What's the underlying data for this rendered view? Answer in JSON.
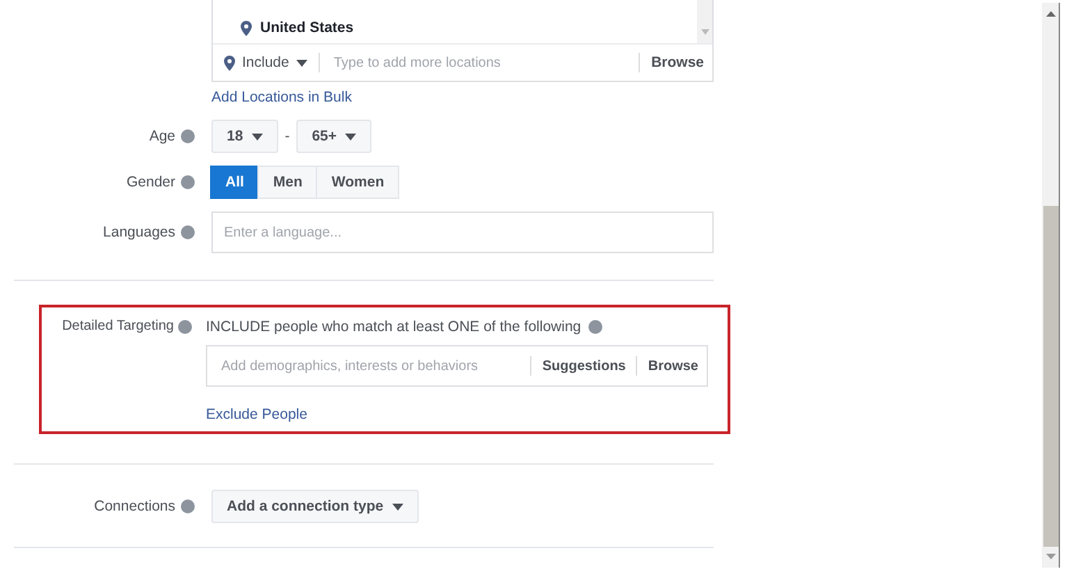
{
  "locations": {
    "selected": [
      "United States"
    ],
    "include_mode": "Include",
    "placeholder": "Type to add more locations",
    "browse": "Browse",
    "bulk_link": "Add Locations in Bulk"
  },
  "age": {
    "label": "Age",
    "min": "18",
    "separator": "-",
    "max": "65+"
  },
  "gender": {
    "label": "Gender",
    "options": [
      {
        "label": "All",
        "selected": true
      },
      {
        "label": "Men",
        "selected": false
      },
      {
        "label": "Women",
        "selected": false
      }
    ]
  },
  "languages": {
    "label": "Languages",
    "placeholder": "Enter a language..."
  },
  "detailed_targeting": {
    "label": "Detailed Targeting",
    "highlighted": true,
    "heading": "INCLUDE people who match at least ONE of the following",
    "placeholder": "Add demographics, interests or behaviors",
    "suggestions": "Suggestions",
    "browse": "Browse",
    "exclude_link": "Exclude People"
  },
  "connections": {
    "label": "Connections",
    "button": "Add a connection type"
  }
}
